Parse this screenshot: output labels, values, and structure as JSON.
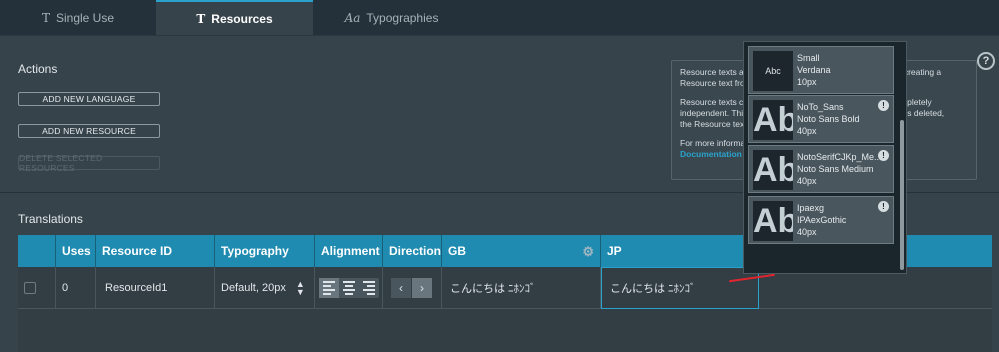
{
  "tabs": [
    {
      "icon": "T",
      "label": "Single Use"
    },
    {
      "icon": "T",
      "label": "Resources"
    },
    {
      "icon": "Aa",
      "label": "Typographies"
    }
  ],
  "actions": {
    "title": "Actions",
    "add_language": "ADD NEW LANGUAGE",
    "add_resource": "ADD NEW RESOURCE",
    "delete_selected": "DELETE SELECTED RESOURCES"
  },
  "info": {
    "p1": "Resource texts ar",
    "p1_end": "r creating a",
    "p1b": "Resource text fro",
    "p2": "Resource texts ca",
    "p2_end": "mpletely",
    "p2b": "independent. Thi",
    "p2b_end": "rce text is deleted,",
    "p2c": "the Resource text",
    "p3": "For more informa",
    "link": "Documentation",
    "help": "?"
  },
  "translations": {
    "title": "Translations",
    "headers": [
      "Uses",
      "Resource ID",
      "Typography",
      "Alignment",
      "Direction",
      "GB",
      "JP"
    ],
    "rows": [
      {
        "uses": "0",
        "resource_id": "ResourceId1",
        "typography": "Default, 20px",
        "gb": "こんにちは ﾆﾎﾝｺﾞ",
        "jp": "こんにちは ﾆﾎﾝｺﾞ"
      }
    ]
  },
  "typography_dropdown": [
    {
      "sample": "Abc",
      "name": "Small",
      "font": "Verdana",
      "size": "10px",
      "warning": false
    },
    {
      "sample": "Abc",
      "name": "NoTo_Sans",
      "font": "Noto Sans Bold",
      "size": "40px",
      "warning": true
    },
    {
      "sample": "Abc",
      "name": "NotoSerifCJKp_Me...",
      "font": "Noto Sans Medium",
      "size": "40px",
      "warning": true
    },
    {
      "sample": "Abc",
      "name": "Ipaexg",
      "font": "IPAexGothic",
      "size": "40px",
      "warning": true
    }
  ],
  "icons": {
    "warning": "!",
    "gear": "⚙",
    "arrow_left": "‹",
    "arrow_right": "›",
    "spin_up": "▲",
    "spin_down": "▼"
  },
  "colors": {
    "accent": "#29a3cc",
    "header_bg": "#1f8bb0",
    "panel_bg": "#37434b",
    "red_mark": "#e0252e"
  }
}
